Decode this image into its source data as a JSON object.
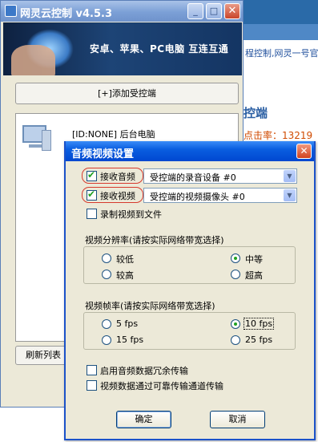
{
  "background_page": {
    "link_text": "程控制,网灵一号官",
    "heading": "控端",
    "click_rate": "点击率：13219"
  },
  "main_window": {
    "title": "网灵云控制 v4.5.3",
    "minimize_glyph": "_",
    "maximize_glyph": "□",
    "close_glyph": "✕",
    "banner_slogan": "安卓、苹果、PC电脑 互连互通",
    "add_button": "[+]添加受控端",
    "devices": [
      {
        "label": "[ID:NONE] 后台电脑"
      }
    ],
    "refresh_button": "刷新列表"
  },
  "dialog": {
    "title": "音频视频设置",
    "close_glyph": "✕",
    "receive_audio": {
      "label": "接收音频",
      "checked": true,
      "device": "受控端的录音设备 #0"
    },
    "receive_video": {
      "label": "接收视频",
      "checked": true,
      "device": "受控端的视频摄像头 #0"
    },
    "record_video": {
      "label": "录制视频到文件",
      "checked": false
    },
    "resolution": {
      "title": "视频分辨率(请按实际网络带宽选择)",
      "options": [
        "较低",
        "中等",
        "较高",
        "超高"
      ],
      "selected": "中等"
    },
    "framerate": {
      "title": "视频帧率(请按实际网络带宽选择)",
      "options": [
        "5 fps",
        "10 fps",
        "15 fps",
        "25 fps"
      ],
      "selected": "10 fps"
    },
    "audio_redundancy": {
      "label": "启用音频数据冗余传输",
      "checked": false
    },
    "reliable_video": {
      "label": "视频数据通过可靠传输通道传输",
      "checked": false
    },
    "ok_button": "确定",
    "cancel_button": "取消",
    "dropdown_arrow": "▼"
  },
  "colors": {
    "dialog_title_bar": "#0a5ee0",
    "highlight_ring": "#d63a2e",
    "check_mark": "#21a121"
  }
}
